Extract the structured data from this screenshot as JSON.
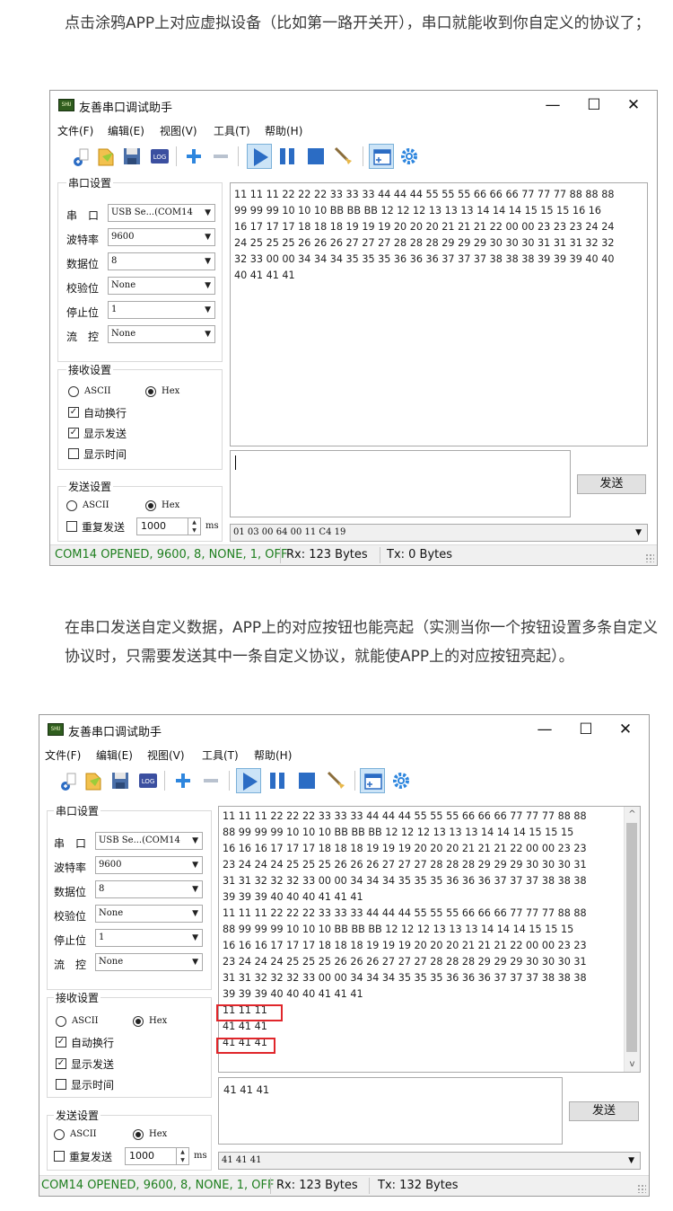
{
  "para1": "点击涂鸦APP上对应虚拟设备（比如第一路开关开），串口就能收到你自定义的协议了；",
  "para2": "在串口发送自定义数据，APP上的对应按钮也能亮起（实测当你一个按钮设置多条自定义协议时，只需要发送其中一条自定义协议，就能使APP上的对应按钮亮起）。",
  "window": {
    "title": "友善串口调试助手",
    "app_icon_text": "SHU",
    "min": "—",
    "max": "☐",
    "close": "✕",
    "menu": [
      "文件(F)",
      "编辑(E)",
      "视图(V)",
      "工具(T)",
      "帮助(H)"
    ],
    "serial_group": "串口设置",
    "port_label": "串　口",
    "port_value": "USB Se...(COM14",
    "baud_label": "波特率",
    "baud_value": "9600",
    "databits_label": "数据位",
    "databits_value": "8",
    "parity_label": "校验位",
    "parity_value": "None",
    "stopbits_label": "停止位",
    "stopbits_value": "1",
    "flow_label": "流　控",
    "flow_value": "None",
    "recv_group": "接收设置",
    "ascii": "ASCII",
    "hex": "Hex",
    "auto_wrap": "自动换行",
    "show_send": "显示发送",
    "show_time": "显示时间",
    "send_group": "发送设置",
    "repeat_send": "重复发送",
    "interval": "1000",
    "ms": "ms",
    "send_button": "发送",
    "status_port": "COM14 OPENED, 9600, 8, NONE, 1, OFF",
    "arrow": "▼",
    "check": "✓",
    "spin_up": "▲",
    "spin_down": "▼"
  },
  "window1": {
    "rx_lines": [
      "11 11 11 22 22 22 33 33 33 44 44 44 55 55 55 66 66 66 77 77 77 88 88 88",
      "99 99 99 10 10 10 BB BB BB 12 12 12 13 13 13 14 14 14 15 15 15 16 16",
      "16 17 17 17 18 18 18 19 19 19 20 20 20 21 21 21 22 00 00 23 23 23 24 24",
      "24 25 25 25 26 26 26 27 27 27 28 28 28 29 29 29 30 30 30 31 31 31 32 32",
      "32 33 00 00 34 34 34 35 35 35 36 36 36 37 37 37 38 38 38 39 39 39 40 40",
      "40 41 41 41"
    ],
    "tx_text": "",
    "history": "01 03 00 64 00 11 C4 19",
    "rx": "Rx: 123 Bytes",
    "tx": "Tx: 0 Bytes"
  },
  "window2": {
    "rx_lines": [
      "11 11 11 22 22 22 33 33 33 44 44 44 55 55 55 66 66 66 77 77 77 88 88",
      "88 99 99 99 10 10 10 BB BB BB 12 12 12 13 13 13 14 14 14 15 15 15",
      "16 16 16 17 17 17 18 18 18 19 19 19 20 20 20 21 21 21 22 00 00 23 23",
      "23 24 24 24 25 25 25 26 26 26 27 27 27 28 28 28 29 29 29 30 30 30 31",
      "31 31 32 32 32 33 00 00 34 34 34 35 35 35 36 36 36 37 37 37 38 38 38",
      "39 39 39 40 40 40 41 41 41",
      "11 11 11 22 22 22 33 33 33 44 44 44 55 55 55 66 66 66 77 77 77 88 88",
      "88 99 99 99 10 10 10 BB BB BB 12 12 12 13 13 13 14 14 14 15 15 15",
      "16 16 16 17 17 17 18 18 18 19 19 19 20 20 20 21 21 21 22 00 00 23 23",
      "23 24 24 24 25 25 25 26 26 26 27 27 27 28 28 28 29 29 29 30 30 30 31",
      "31 31 32 32 32 33 00 00 34 34 34 35 35 35 36 36 36 37 37 37 38 38 38",
      "39 39 39 40 40 40 41 41 41",
      "11 11 11",
      "41 41 41",
      "41 41 41"
    ],
    "tx_text": "41 41 41",
    "history": "41 41 41",
    "rx": "Rx: 123 Bytes",
    "tx": "Tx: 132 Bytes",
    "scroll_up": "^",
    "scroll_down": "v"
  }
}
